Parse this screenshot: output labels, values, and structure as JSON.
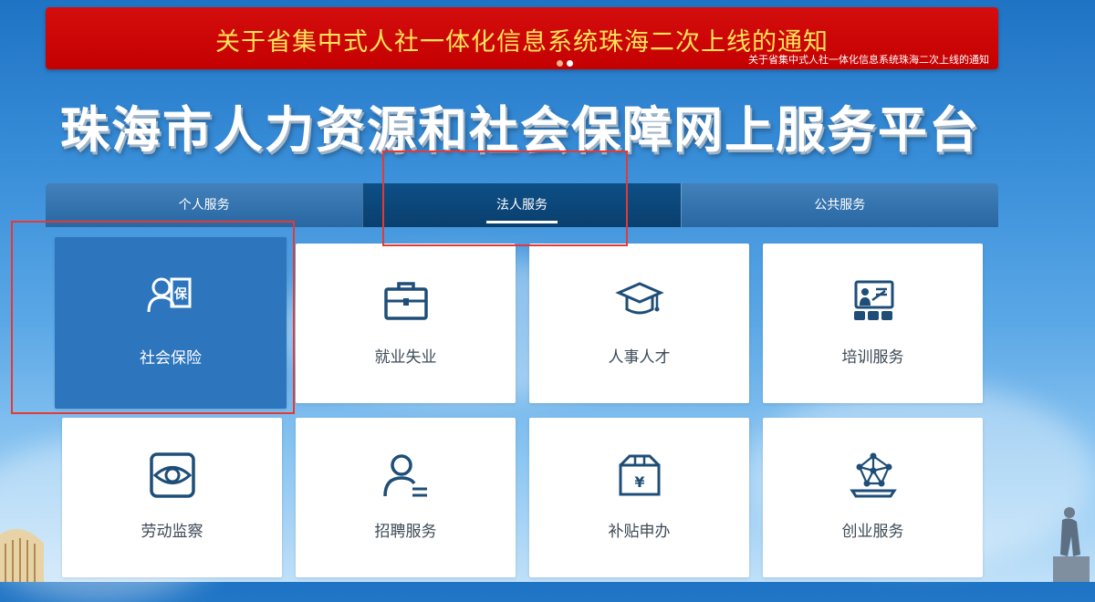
{
  "banner": {
    "title": "关于省集中式人社一体化信息系统珠海二次上线的通知",
    "subtitle": "关于省集中式人社一体化信息系统珠海二次上线的通知"
  },
  "site": {
    "title": "珠海市人力资源和社会保障网上服务平台"
  },
  "tabs": [
    {
      "label": "个人服务"
    },
    {
      "label": "法人服务",
      "active": true
    },
    {
      "label": "公共服务"
    }
  ],
  "services": [
    {
      "label": "社会保险",
      "icon": "insurance-icon",
      "active": true
    },
    {
      "label": "就业失业",
      "icon": "briefcase-icon"
    },
    {
      "label": "人事人才",
      "icon": "graduation-cap-icon"
    },
    {
      "label": "培训服务",
      "icon": "training-icon"
    },
    {
      "label": "劳动监察",
      "icon": "eye-icon"
    },
    {
      "label": "招聘服务",
      "icon": "recruit-icon"
    },
    {
      "label": "补贴申办",
      "icon": "subsidy-icon"
    },
    {
      "label": "创业服务",
      "icon": "network-icon"
    }
  ],
  "colors": {
    "banner_red": "#c50000",
    "banner_text": "#ffe35a",
    "tile_active": "#2d75bd",
    "icon_navy": "#1e4e78",
    "annotation_red": "#e53935"
  }
}
